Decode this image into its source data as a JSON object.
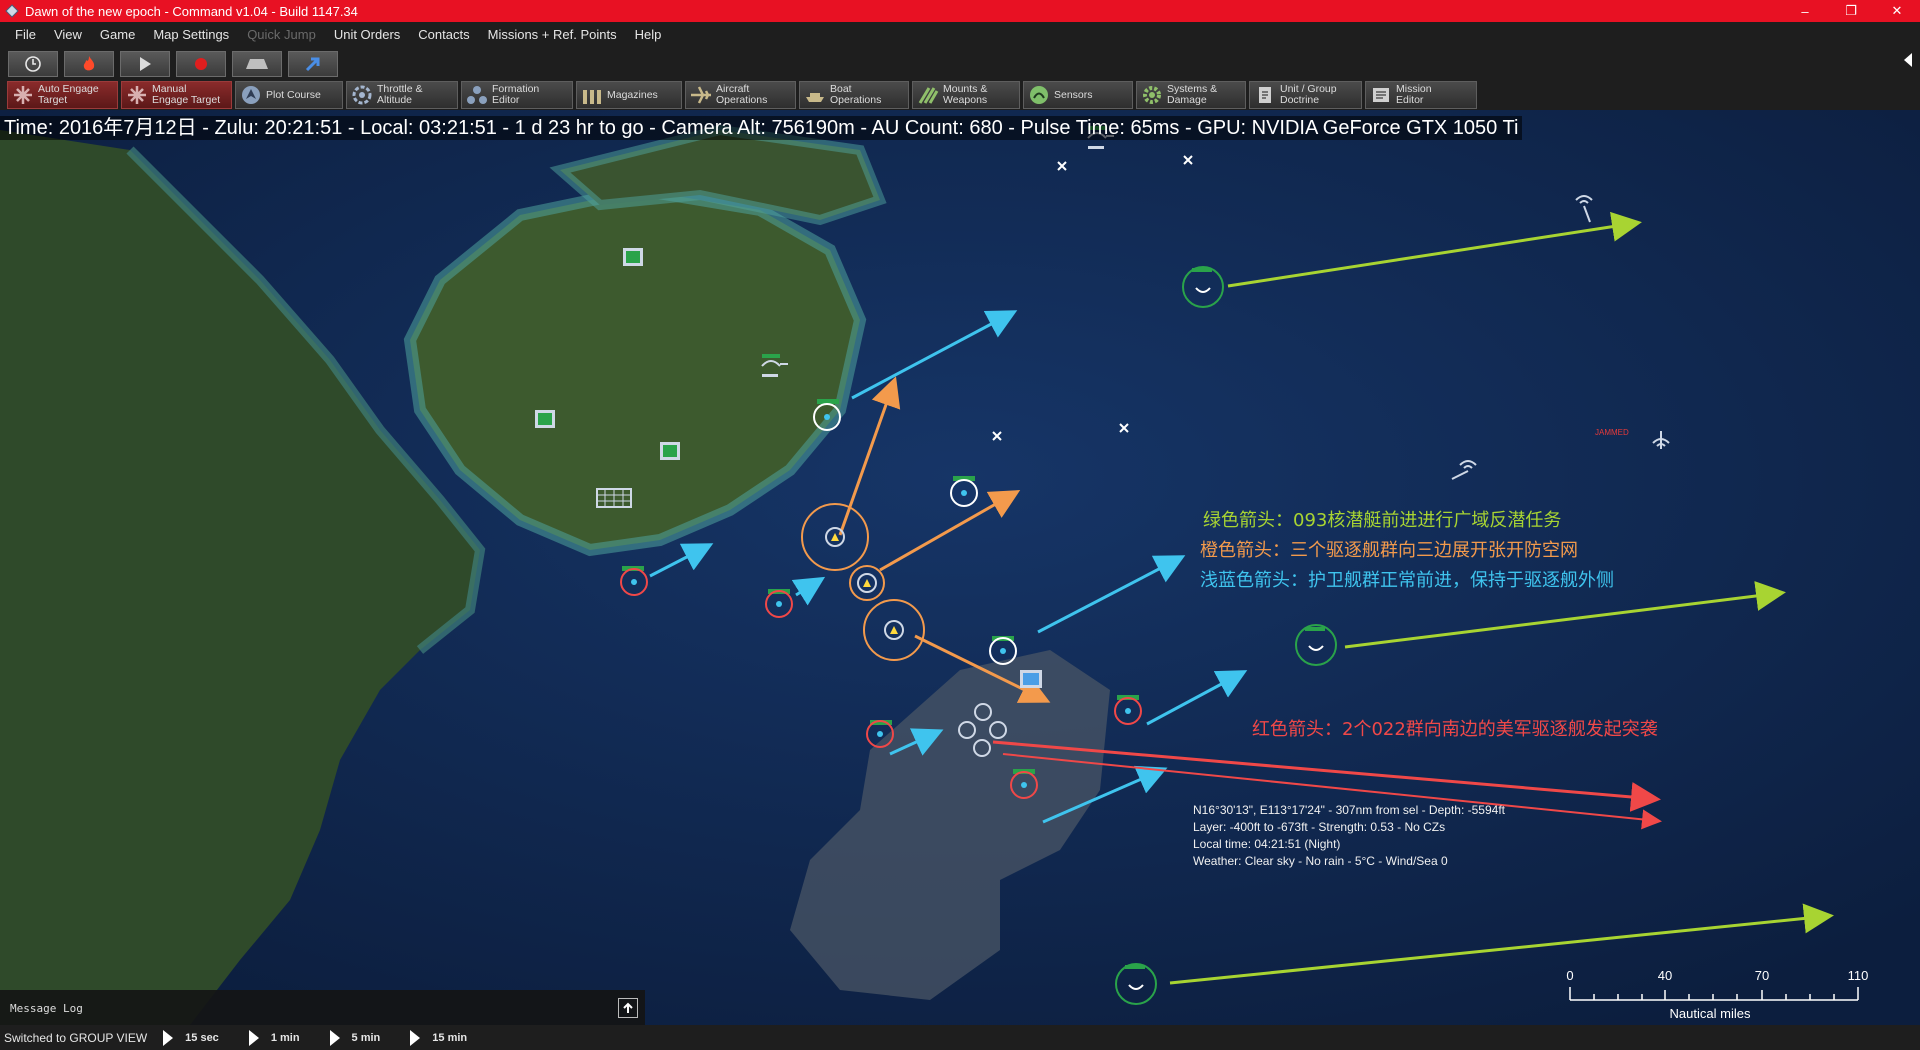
{
  "window": {
    "title": "Dawn of the new epoch - Command v1.04 - Build 1147.34",
    "minimize": "–",
    "restore": "❐",
    "close": "✕"
  },
  "menu": [
    "File",
    "View",
    "Game",
    "Map Settings",
    "Quick Jump",
    "Unit Orders",
    "Contacts",
    "Missions + Ref. Points",
    "Help"
  ],
  "menu_disabled": "Quick Jump",
  "toolbar": [
    {
      "l1": "Auto Engage",
      "l2": "Target",
      "icon": "auto-engage-icon"
    },
    {
      "l1": "Manual",
      "l2": "Engage Target",
      "icon": "manual-engage-icon"
    },
    {
      "l1": "Plot Course",
      "l2": "",
      "icon": "plot-course-icon"
    },
    {
      "l1": "Throttle &",
      "l2": "Altitude",
      "icon": "throttle-icon"
    },
    {
      "l1": "Formation",
      "l2": "Editor",
      "icon": "formation-icon"
    },
    {
      "l1": "Magazines",
      "l2": "",
      "icon": "magazines-icon"
    },
    {
      "l1": "Aircraft",
      "l2": "Operations",
      "icon": "aircraft-icon"
    },
    {
      "l1": "Boat",
      "l2": "Operations",
      "icon": "boat-icon"
    },
    {
      "l1": "Mounts &",
      "l2": "Weapons",
      "icon": "weapons-icon"
    },
    {
      "l1": "Sensors",
      "l2": "",
      "icon": "sensors-icon"
    },
    {
      "l1": "Systems &",
      "l2": "Damage",
      "icon": "systems-icon"
    },
    {
      "l1": "Unit / Group",
      "l2": "Doctrine",
      "icon": "doctrine-icon"
    },
    {
      "l1": "Mission",
      "l2": "Editor",
      "icon": "mission-editor-icon"
    }
  ],
  "status_line": "Time: 2016年7月12日 - Zulu: 20:21:51 - Local: 03:21:51 - 1 d 23 hr to go -  Camera Alt: 756190m  - AU Count: 680 - Pulse Time: 65ms - GPU: NVIDIA GeForce GTX 1050 Ti",
  "annotations": {
    "green": "绿色箭头：093核潜艇前进进行广域反潜任务",
    "orange": "橙色箭头：三个驱逐舰群向三边展开张开防空网",
    "cyan": "浅蓝色箭头：护卫舰群正常前进，保持于驱逐舰外侧",
    "red": "红色箭头：2个022群向南边的美军驱逐舰发起突袭"
  },
  "info": {
    "line1": "N16°30'13\", E113°17'24\" - 307nm from sel - Depth: -5594ft",
    "line2": "Layer: -400ft to -673ft - Strength: 0.53 - No CZs",
    "line3": "Local time: 04:21:51 (Night)",
    "line4": "Weather: Clear sky - No rain - 5°C - Wind/Sea 0"
  },
  "jammed": "JAMMED",
  "scale": {
    "labels": [
      "0",
      "40",
      "70",
      "110"
    ],
    "unit": "Nautical miles"
  },
  "message_log": "Message Log",
  "status_bar": "Switched to GROUP VIEW",
  "speeds": [
    "15 sec",
    "1 min",
    "5 min",
    "15 min"
  ],
  "colors": {
    "green": "#a8d432",
    "orange": "#f39a4c",
    "cyan": "#3fc4ee",
    "red": "#f04848",
    "titlebar": "#e81123"
  }
}
